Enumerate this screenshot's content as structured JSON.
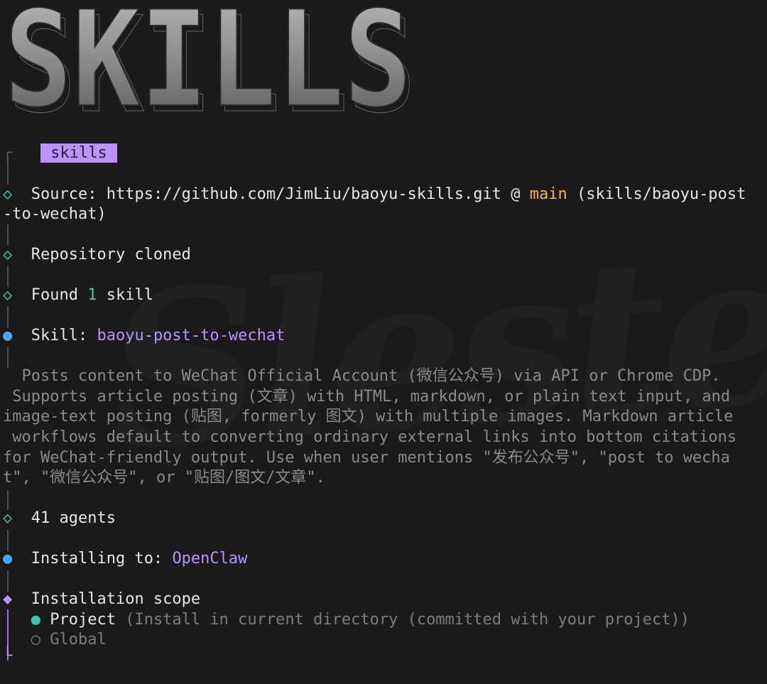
{
  "banner": {
    "text": "SKILLS"
  },
  "watermark": {
    "text": "Slesterm"
  },
  "header_tag": "skills",
  "source": {
    "label": "Source: ",
    "url": "https://github.com/JimLiu/baoyu-skills.git",
    "at": " @ ",
    "branch": "main",
    "path_a": " (skills/baoyu-post",
    "path_b": "-to-wechat)"
  },
  "cloned": "Repository cloned",
  "found": {
    "pre": "Found ",
    "count": "1",
    "post": " skill"
  },
  "skill": {
    "label": "Skill: ",
    "name": "baoyu-post-to-wechat"
  },
  "description": [
    "  Posts content to WeChat Official Account (微信公众号) via API or Chrome CDP.",
    " Supports article posting (文章) with HTML, markdown, or plain text input, and",
    "image-text posting (贴图, formerly 图文) with multiple images. Markdown article",
    " workflows default to converting ordinary external links into bottom citations",
    "for WeChat-friendly output. Use when user mentions \"发布公众号\", \"post to wecha",
    "t\", \"微信公众号\", or \"贴图/图文/文章\"."
  ],
  "agents": "41 agents",
  "installing": {
    "label": "Installing to: ",
    "target": "OpenClaw"
  },
  "scope": {
    "title": "Installation scope",
    "options": [
      {
        "label": "Project",
        "hint": "(Install in current directory (committed with your project))",
        "selected": true
      },
      {
        "label": "Global",
        "hint": "",
        "selected": false
      }
    ]
  },
  "symbols": {
    "done": "◇",
    "active": "●",
    "prompt": "◆",
    "unselected": "○",
    "corner_top": "┌",
    "corner_bottom": "└"
  },
  "colors": {
    "teal": "#36c9b0",
    "blue": "#48a6ee",
    "purple": "#bd93f9",
    "orange": "#ffb34a",
    "background": "#1a1a1a"
  }
}
